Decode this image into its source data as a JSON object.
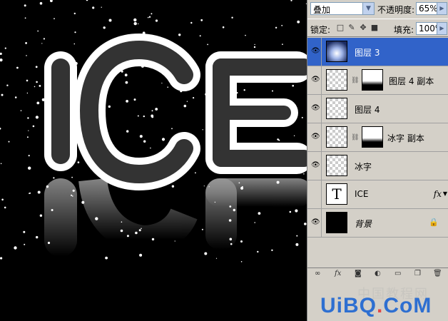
{
  "canvas": {
    "text": "ICE",
    "reflection_text": "ICE"
  },
  "panel": {
    "blend_mode": "叠加",
    "opacity_label": "不透明度:",
    "opacity_value": "65%",
    "lock_label": "锁定:",
    "fill_label": "填充:",
    "fill_value": "100%",
    "lock_icons": [
      "lock-transparency-icon",
      "lock-brush-icon",
      "lock-move-icon",
      "lock-all-icon"
    ]
  },
  "layers": [
    {
      "name": "图层 3",
      "selected": true,
      "visible": true,
      "thumb": "glow"
    },
    {
      "name": "图层 4 副本",
      "selected": false,
      "visible": true,
      "thumb": "checker",
      "mask": true
    },
    {
      "name": "图层 4",
      "selected": false,
      "visible": true,
      "thumb": "checker"
    },
    {
      "name": "冰字 副本",
      "selected": false,
      "visible": true,
      "thumb": "checker",
      "mask": true
    },
    {
      "name": "冰字",
      "selected": false,
      "visible": true,
      "thumb": "checker"
    },
    {
      "name": "ICE",
      "selected": false,
      "visible": false,
      "thumb": "T",
      "fx": "fx"
    },
    {
      "name": "背景",
      "selected": false,
      "visible": true,
      "thumb": "black",
      "locked": true
    }
  ],
  "bottom_toolbar": [
    "link-icon",
    "fx-icon",
    "mask-icon",
    "adjustment-icon",
    "folder-icon",
    "new-layer-icon",
    "trash-icon"
  ],
  "watermark": {
    "cn": "中国教程网",
    "en_part1": "UiBQ",
    "en_dot": ".",
    "en_part2": "CoM"
  }
}
